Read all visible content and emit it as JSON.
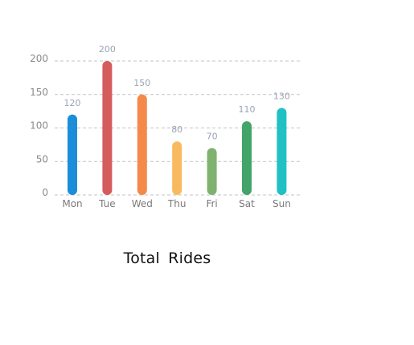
{
  "chart_data": {
    "type": "bar",
    "title": "Total  Rides",
    "categories": [
      "Mon",
      "Tue",
      "Wed",
      "Thu",
      "Fri",
      "Sat",
      "Sun"
    ],
    "values": [
      120,
      200,
      150,
      80,
      70,
      110,
      130
    ],
    "data_labels": [
      "120",
      "200",
      "150",
      "80",
      "70",
      "110",
      "130"
    ],
    "colors": [
      "#1a8ed8",
      "#d45c5c",
      "#f5894a",
      "#f9b95e",
      "#7fb26f",
      "#43a46a",
      "#20c0c4"
    ],
    "ylim": [
      0,
      200
    ],
    "yticks": [
      0,
      50,
      100,
      150,
      200
    ],
    "ytick_labels": [
      "0",
      "50",
      "100",
      "150",
      "200"
    ],
    "grid": true,
    "xlabel": "",
    "ylabel": ""
  }
}
